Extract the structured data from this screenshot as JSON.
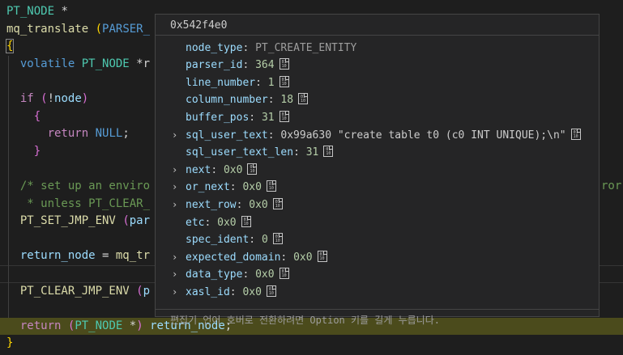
{
  "editor": {
    "lines": [
      {
        "parts": [
          [
            "type",
            "PT_NODE"
          ],
          [
            "punc",
            " *"
          ]
        ]
      },
      {
        "parts": [
          [
            "fn",
            "mq_translate"
          ],
          [
            "punc",
            " "
          ],
          [
            "brk",
            "("
          ],
          [
            "macro",
            "PARSER_"
          ]
        ]
      },
      {
        "parts": [
          [
            "brk",
            "{"
          ]
        ]
      },
      {
        "parts": [
          [
            "punc",
            "  "
          ],
          [
            "kw2",
            "volatile"
          ],
          [
            "punc",
            " "
          ],
          [
            "type",
            "PT_NODE"
          ],
          [
            "punc",
            " *r"
          ]
        ]
      },
      {
        "parts": []
      },
      {
        "parts": [
          [
            "punc",
            "  "
          ],
          [
            "kw",
            "if"
          ],
          [
            "punc",
            " "
          ],
          [
            "brk2",
            "("
          ],
          [
            "punc",
            "!"
          ],
          [
            "var",
            "node"
          ],
          [
            "brk2",
            ")"
          ]
        ]
      },
      {
        "parts": [
          [
            "punc",
            "    "
          ],
          [
            "brk2",
            "{"
          ]
        ]
      },
      {
        "parts": [
          [
            "punc",
            "      "
          ],
          [
            "kw",
            "return"
          ],
          [
            "punc",
            " "
          ],
          [
            "macro",
            "NULL"
          ],
          [
            "punc",
            ";"
          ]
        ]
      },
      {
        "parts": [
          [
            "punc",
            "    "
          ],
          [
            "brk2",
            "}"
          ]
        ]
      },
      {
        "parts": []
      },
      {
        "parts": [
          [
            "punc",
            "  "
          ],
          [
            "cmt",
            "/* set up an enviro"
          ]
        ],
        "tail": [
          [
            "cmt",
            "ror"
          ]
        ]
      },
      {
        "parts": [
          [
            "punc",
            "  "
          ],
          [
            "cmt",
            " * unless PT_CLEAR_"
          ]
        ]
      },
      {
        "parts": [
          [
            "punc",
            "  "
          ],
          [
            "fn",
            "PT_SET_JMP_ENV"
          ],
          [
            "punc",
            " "
          ],
          [
            "brk2",
            "("
          ],
          [
            "var",
            "par"
          ]
        ]
      },
      {
        "parts": []
      },
      {
        "parts": [
          [
            "punc",
            "  "
          ],
          [
            "var",
            "return_node"
          ],
          [
            "punc",
            " = "
          ],
          [
            "fn",
            "mq_tr"
          ]
        ]
      },
      {
        "parts": []
      },
      {
        "parts": [
          [
            "punc",
            "  "
          ],
          [
            "fn",
            "PT_CLEAR_JMP_ENV"
          ],
          [
            "punc",
            " "
          ],
          [
            "brk2",
            "("
          ],
          [
            "var",
            "p"
          ]
        ]
      },
      {
        "parts": []
      },
      {
        "parts": [
          [
            "punc",
            "  "
          ],
          [
            "kw",
            "return"
          ],
          [
            "punc",
            " "
          ],
          [
            "brk2",
            "("
          ],
          [
            "type",
            "PT_NODE"
          ],
          [
            "punc",
            " *"
          ],
          [
            "brk2",
            ")"
          ],
          [
            "punc",
            " "
          ],
          [
            "var",
            "return_node"
          ],
          [
            "punc",
            ";"
          ]
        ]
      },
      {
        "parts": [
          [
            "brk",
            "}"
          ]
        ]
      }
    ]
  },
  "hover": {
    "title": "0x542f4e0",
    "rows": [
      {
        "key": "node_type",
        "value": "PT_CREATE_ENTITY",
        "vtype": "enum",
        "expandable": false,
        "icon": false
      },
      {
        "key": "parser_id",
        "value": "364",
        "vtype": "num",
        "expandable": false,
        "icon": true
      },
      {
        "key": "line_number",
        "value": "1",
        "vtype": "num",
        "expandable": false,
        "icon": true
      },
      {
        "key": "column_number",
        "value": "18",
        "vtype": "num",
        "expandable": false,
        "icon": true
      },
      {
        "key": "buffer_pos",
        "value": "31",
        "vtype": "num",
        "expandable": false,
        "icon": true
      },
      {
        "key": "sql_user_text",
        "value": "0x99a630 \"create table t0 (c0 INT UNIQUE);\\n\"",
        "vtype": "str",
        "expandable": true,
        "icon": true
      },
      {
        "key": "sql_user_text_len",
        "value": "31",
        "vtype": "num",
        "expandable": false,
        "icon": true
      },
      {
        "key": "next",
        "value": "0x0",
        "vtype": "num",
        "expandable": true,
        "icon": true
      },
      {
        "key": "or_next",
        "value": "0x0",
        "vtype": "num",
        "expandable": true,
        "icon": true
      },
      {
        "key": "next_row",
        "value": "0x0",
        "vtype": "num",
        "expandable": true,
        "icon": true
      },
      {
        "key": "etc",
        "value": "0x0",
        "vtype": "num",
        "expandable": false,
        "icon": true
      },
      {
        "key": "spec_ident",
        "value": "0",
        "vtype": "num",
        "expandable": false,
        "icon": true
      },
      {
        "key": "expected_domain",
        "value": "0x0",
        "vtype": "num",
        "expandable": true,
        "icon": true
      },
      {
        "key": "data_type",
        "value": "0x0",
        "vtype": "num",
        "expandable": true,
        "icon": true
      },
      {
        "key": "xasl_id",
        "value": "0x0",
        "vtype": "num",
        "expandable": true,
        "icon": true
      }
    ],
    "footer": "편집기 언어 호버로 전환하려면 Option 키를 길게 누릅니다.",
    "chevron_glyph": "›",
    "icon_bits_top": "01",
    "icon_bits_bottom": "10"
  }
}
